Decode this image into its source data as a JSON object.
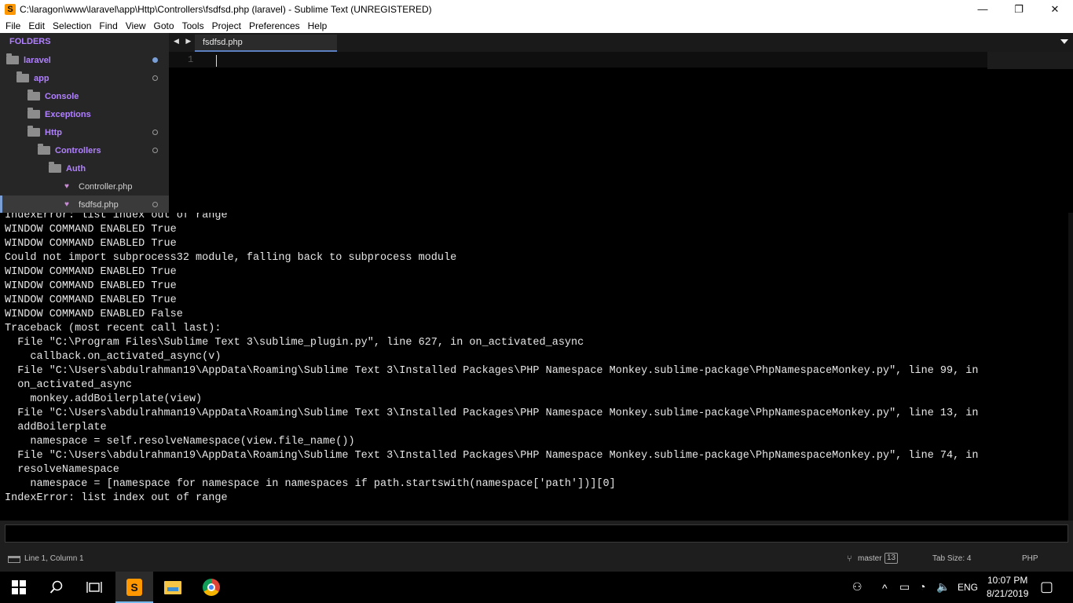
{
  "window": {
    "title": "C:\\laragon\\www\\laravel\\app\\Http\\Controllers\\fsdfsd.php (laravel) - Sublime Text (UNREGISTERED)",
    "logo": "S",
    "controls": {
      "minimize": "—",
      "maximize": "❐",
      "close": "✕"
    }
  },
  "menu": [
    "File",
    "Edit",
    "Selection",
    "Find",
    "View",
    "Goto",
    "Tools",
    "Project",
    "Preferences",
    "Help"
  ],
  "sidebar": {
    "heading": "FOLDERS",
    "items": [
      {
        "label": "laravel",
        "kind": "folder",
        "indicator": "modified"
      },
      {
        "label": "app",
        "kind": "folder",
        "indicator": "open"
      },
      {
        "label": "Console",
        "kind": "folder",
        "indicator": "none"
      },
      {
        "label": "Exceptions",
        "kind": "folder",
        "indicator": "none"
      },
      {
        "label": "Http",
        "kind": "folder",
        "indicator": "open"
      },
      {
        "label": "Controllers",
        "kind": "folder",
        "indicator": "open"
      },
      {
        "label": "Auth",
        "kind": "folder",
        "indicator": "none"
      },
      {
        "label": "Controller.php",
        "kind": "file",
        "indicator": "none"
      },
      {
        "label": "fsdfsd.php",
        "kind": "file",
        "indicator": "open",
        "selected": true
      }
    ]
  },
  "editor": {
    "tab_arrows": "◀ ▶",
    "active_tab": "fsdfsd.php",
    "line_number": "1"
  },
  "console": {
    "lines": [
      "IndexError: list index out of range",
      "WINDOW COMMAND ENABLED True",
      "WINDOW COMMAND ENABLED True",
      "Could not import subprocess32 module, falling back to subprocess module",
      "WINDOW COMMAND ENABLED True",
      "WINDOW COMMAND ENABLED True",
      "WINDOW COMMAND ENABLED True",
      "WINDOW COMMAND ENABLED False",
      "Traceback (most recent call last):",
      "  File \"C:\\Program Files\\Sublime Text 3\\sublime_plugin.py\", line 627, in on_activated_async",
      "    callback.on_activated_async(v)",
      "  File \"C:\\Users\\abdulrahman19\\AppData\\Roaming\\Sublime Text 3\\Installed Packages\\PHP Namespace Monkey.sublime-package\\PhpNamespaceMonkey.py\", line 99, in",
      "  on_activated_async",
      "    monkey.addBoilerplate(view)",
      "  File \"C:\\Users\\abdulrahman19\\AppData\\Roaming\\Sublime Text 3\\Installed Packages\\PHP Namespace Monkey.sublime-package\\PhpNamespaceMonkey.py\", line 13, in",
      "  addBoilerplate",
      "    namespace = self.resolveNamespace(view.file_name())",
      "  File \"C:\\Users\\abdulrahman19\\AppData\\Roaming\\Sublime Text 3\\Installed Packages\\PHP Namespace Monkey.sublime-package\\PhpNamespaceMonkey.py\", line 74, in",
      "  resolveNamespace",
      "    namespace = [namespace for namespace in namespaces if path.startswith(namespace['path'])][0]",
      "IndexError: list index out of range"
    ]
  },
  "status": {
    "position": "Line 1, Column 1",
    "git_branch": "master",
    "git_count": "13",
    "tab_size": "Tab Size: 4",
    "syntax": "PHP"
  },
  "taskbar": {
    "sublime_glyph": "S",
    "tray": {
      "people": "⚇",
      "chevron": "^",
      "battery": "▭",
      "wifi": "◔",
      "volume": "🔈",
      "language": "ENG",
      "notification": "▢"
    },
    "clock_time": "10:07 PM",
    "clock_date": "8/21/2019"
  }
}
